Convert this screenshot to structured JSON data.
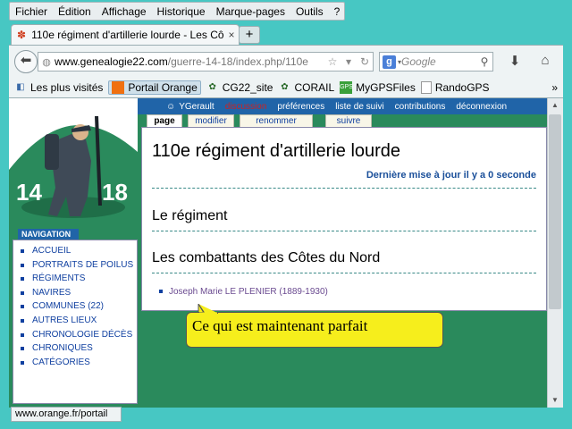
{
  "menu": {
    "items": [
      "Fichier",
      "Édition",
      "Affichage",
      "Historique",
      "Marque-pages",
      "Outils",
      "?"
    ]
  },
  "tab": {
    "title": "110e régiment d'artillerie lourde - Les Cô…",
    "close": "×",
    "new_tab": "+"
  },
  "navbar": {
    "url_domain": "www.genealogie22.com",
    "url_path": "/guerre-14-18/index.php/110e",
    "search_placeholder": "Google",
    "search_engine_letter": "g"
  },
  "bookmarks": [
    {
      "label": "Les plus visités",
      "icon": "bookmark-icon"
    },
    {
      "label": "Portail Orange",
      "icon": "orange-icon",
      "active": true
    },
    {
      "label": "CG22_site",
      "icon": "cg22-icon"
    },
    {
      "label": "CORAIL",
      "icon": "corail-icon"
    },
    {
      "label": "MyGPSFiles",
      "icon": "mygps-icon"
    },
    {
      "label": "RandoGPS",
      "icon": "page-icon"
    }
  ],
  "logo": {
    "left_number": "14",
    "right_number": "18"
  },
  "sidebar": {
    "heading": "NAVIGATION",
    "items": [
      "ACCUEIL",
      "PORTRAITS DE POILUS",
      "RÉGIMENTS",
      "NAVIRES",
      "COMMUNES (22)",
      "AUTRES LIEUX",
      "CHRONOLOGIE DÉCÈS",
      "CHRONIQUES",
      "CATÉGORIES"
    ]
  },
  "userbar": {
    "user": "YGerault",
    "discussion": "discussion",
    "preferences": "préférences",
    "watchlist": "liste de suivi",
    "contributions": "contributions",
    "logout": "déconnexion"
  },
  "page_tabs": [
    "page",
    "modifier",
    "renommer",
    "suivre"
  ],
  "article": {
    "title": "110e régiment d'artillerie lourde",
    "last_modified": "Dernière mise à jour il y a 0 seconde",
    "section1": "Le régiment",
    "section2": "Les combattants des Côtes du Nord",
    "person": "Joseph Marie LE PLENIER (1889-1930)"
  },
  "status_url": "www.orange.fr/portail",
  "callout_text": "Ce qui est maintenant parfait",
  "colors": {
    "desktop": "#47c7c3",
    "site_green": "#2a8a5c",
    "site_blue": "#2064a8",
    "callout": "#f6ee1c"
  }
}
